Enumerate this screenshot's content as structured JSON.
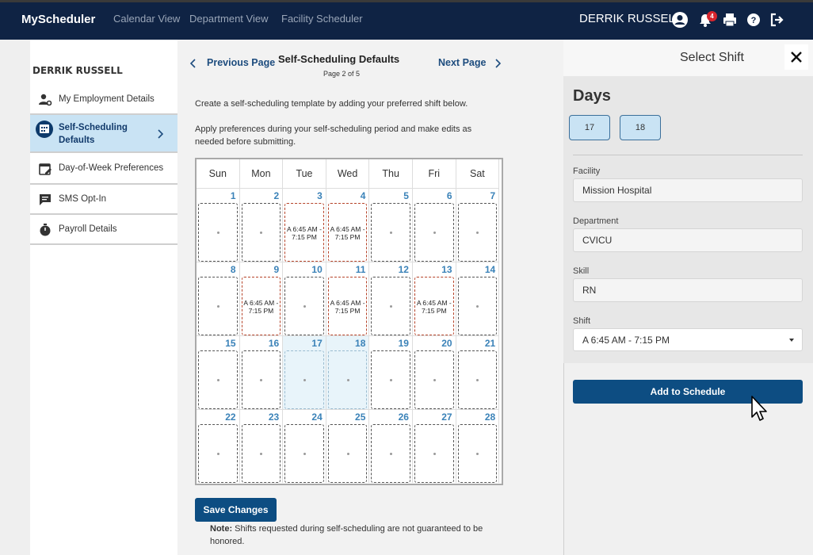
{
  "header": {
    "brand": "MyScheduler",
    "nav": [
      "Calendar View",
      "Department View",
      "Facility Scheduler"
    ],
    "user_name": "DERRIK RUSSELL",
    "notification_count": "4"
  },
  "sidebar": {
    "heading": "DERRIK RUSSELL",
    "items": [
      {
        "label": "My Employment Details",
        "icon": "user-gear-icon"
      },
      {
        "label": "Self-Scheduling Defaults",
        "icon": "calendar-icon"
      },
      {
        "label": "Day-of-Week Preferences",
        "icon": "calendar-edit-icon"
      },
      {
        "label": "SMS Opt-In",
        "icon": "message-icon"
      },
      {
        "label": "Payroll Details",
        "icon": "stopwatch-icon"
      }
    ]
  },
  "main": {
    "prev_label": "Previous Page",
    "next_label": "Next Page",
    "title": "Self-Scheduling Defaults",
    "page_indicator": "Page 2 of 5",
    "desc1": "Create a self-scheduling template by adding your preferred shift below.",
    "desc2": "Apply preferences during your self-scheduling period and make edits as needed before submitting.",
    "weekdays": [
      "Sun",
      "Mon",
      "Tue",
      "Wed",
      "Thu",
      "Fri",
      "Sat"
    ],
    "shift_line1": "A 6:45 AM -",
    "shift_line2": "7:15 PM",
    "save_label": "Save Changes",
    "note_label": "Note:",
    "note_text": " Shifts requested during self-scheduling are not guaranteed to be honored."
  },
  "calendar": {
    "weeks": [
      [
        1,
        2,
        3,
        4,
        5,
        6,
        7
      ],
      [
        8,
        9,
        10,
        11,
        12,
        13,
        14
      ],
      [
        15,
        16,
        17,
        18,
        19,
        20,
        21
      ],
      [
        22,
        23,
        24,
        25,
        26,
        27,
        28
      ]
    ],
    "shift_days": [
      3,
      4,
      9,
      11,
      13
    ],
    "selected_days": [
      17,
      18
    ]
  },
  "panel": {
    "title": "Select Shift",
    "days_heading": "Days",
    "days": [
      "17",
      "18"
    ],
    "facility_label": "Facility",
    "facility_value": "Mission Hospital",
    "department_label": "Department",
    "department_value": "CVICU",
    "skill_label": "Skill",
    "skill_value": "RN",
    "shift_label": "Shift",
    "shift_value": "A 6:45 AM - 7:15 PM",
    "add_label": "Add to Schedule"
  }
}
